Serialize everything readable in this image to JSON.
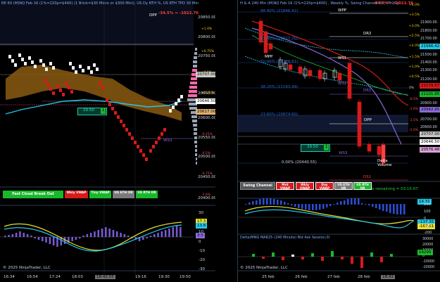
{
  "left_chart": {
    "header": "RE 60 (M)NQ Feb 16  (1%=220p=$440) (1 Brick=$30 Micro or $300 Mini), US Dy RTH %, US RTH TPO 30 Min",
    "dpp_label": "DPP",
    "pnl": "-34.5% = -1022.76",
    "price_ticks": [
      "20850.00",
      "20800.00",
      "20750.00",
      "20700.00",
      "20650.00",
      "20600.00",
      "20550.00",
      "20500.00",
      "20450.00",
      "20400.00"
    ],
    "pct_ticks": [
      "+1.0%",
      "+0.75%",
      "+0.5%",
      "+0.25%",
      "0%",
      "-0.25%",
      "-0.5%",
      "-0.75%",
      "-1.0%"
    ],
    "price_tags": [
      {
        "text": "20707.00",
        "color": "#c8c8c8"
      },
      {
        "text": "20646.50",
        "color": "#ffffff"
      },
      {
        "text": "20617.00",
        "color": "#e0b070"
      }
    ],
    "box_value": "29.50",
    "box_marker": "1",
    "ws3_label": "WS3",
    "buttons": [
      {
        "label": "Fast Cloud Break Out",
        "color": "#19b82c"
      },
      {
        "label": "Wkly VWAP",
        "color": "#d81a1a"
      },
      {
        "label": "Tiny VWAP",
        "color": "#19b82c"
      },
      {
        "label": "US ETH OR",
        "color": "#7a7a7a"
      },
      {
        "label": "US RTH OR",
        "color": "#19b82c"
      }
    ],
    "copyright": "© 2025 NinjaTrader, LLC",
    "osc_ticks": [
      "30",
      "20",
      "10",
      "0",
      "-10",
      "-20",
      "-30"
    ],
    "osc_tags": [
      {
        "text": "17.3",
        "color": "#e8e030"
      },
      {
        "text": "13.8",
        "color": "#22c8e8"
      },
      {
        "text": "3.5",
        "color": "#8a6ad8"
      }
    ],
    "time_labels": [
      "16:34",
      "16:54",
      "17:24",
      "18:03",
      "18:42:55",
      "19:16",
      "19:30",
      "19:50"
    ]
  },
  "right_chart": {
    "header": "H & A 240 Min (M)NQ Feb 16  (1%=220p=$400) , Weekly %, Swing Channel BO, PP 20p",
    "pnl": "-34.5% = -1022.76",
    "levels": [
      {
        "text": "88.40% (21846.42)"
      },
      {
        "text": "61.80% (21527.70)"
      },
      {
        "text": "50.00% (21388.61)"
      },
      {
        "text": "38.20% (21143.49)"
      },
      {
        "text": "23.60% (20874.60)"
      },
      {
        "text": "0.00% (20440.55)"
      }
    ],
    "pivots": [
      "WPP",
      "DR2",
      "WS1",
      "MPP",
      "WS2",
      "DR1",
      "DPP",
      "WS3",
      "DS1"
    ],
    "price_ticks": [
      "21900.00",
      "21800.00",
      "21700.00",
      "21600.00",
      "21500.00",
      "21400.00",
      "21300.00",
      "21200.00",
      "21100.00",
      "21000.00",
      "20900.00",
      "20800.00",
      "20700.00",
      "20600.00",
      "20500.00",
      "20400.00"
    ],
    "pct_ticks": [
      "+4.0%",
      "+3.5%",
      "+3.0%",
      "+2.5%",
      "+2.0%",
      "+1.5%",
      "+1.0%",
      "+0.5%",
      "0%",
      "-0.5%",
      "-1.0%",
      "-1.5%",
      "-2.0%"
    ],
    "price_tags": [
      {
        "text": "21566.42",
        "color": "#22c8e8"
      },
      {
        "text": "21179.57",
        "color": "#d81a1a"
      },
      {
        "text": "21101.95",
        "color": "#19b82c"
      },
      {
        "text": "20942.95",
        "color": "#8a6ad8"
      },
      {
        "text": "20707.00",
        "color": "#c8c8c8"
      },
      {
        "text": "20646.50",
        "color": "#ffffff"
      },
      {
        "text": "20576.48",
        "color": "#d8a0d8"
      }
    ],
    "box_value": "29.50",
    "box_marker": "1",
    "delta_label": "Delta\nVolume",
    "timer": "Time remaining = 03:15:07",
    "swing_label": "Swing Channel BO",
    "buttons": [
      {
        "label": "Mnt VWAP",
        "color": "#d81a1a"
      },
      {
        "label": "Wkly VWAP",
        "color": "#d81a1a"
      },
      {
        "label": "Day VWAP",
        "color": "#d81a1a"
      },
      {
        "label": "US ETH OR",
        "color": "#7a7a7a"
      },
      {
        "label": "US RTH OR",
        "color": "#19b82c"
      }
    ],
    "osc_tags": [
      {
        "text": "14.31",
        "color": "#22c8e8"
      },
      {
        "text": "-137.35",
        "color": "#22c8e8"
      },
      {
        "text": "-167.61",
        "color": "#e8e030"
      }
    ],
    "osc_ticks": [
      "200",
      "100",
      "0",
      "-100",
      "-200"
    ],
    "delta_header": "Delta(MNQ MAR25 (240 Minute) Bid Ask Session,0)",
    "delta_ticks": [
      "30000",
      "20000",
      "10000",
      "0",
      "-10000",
      "-20000",
      "-30000"
    ],
    "delta_tag": {
      "text": "14295",
      "color": "#19b82c"
    },
    "copyright": "© 2025 NinjaTrader, LLC",
    "time_labels": [
      "25 feb",
      "26 feb",
      "27 feb",
      "28 feb",
      "18:43"
    ]
  }
}
